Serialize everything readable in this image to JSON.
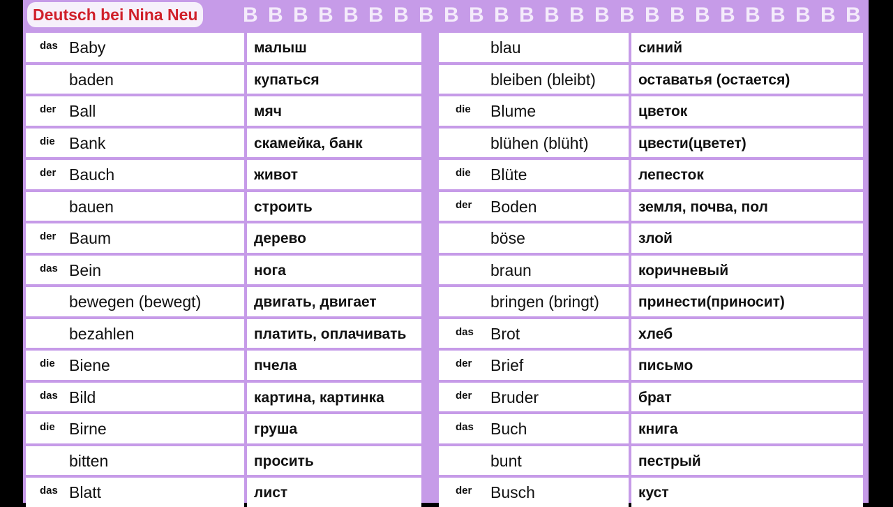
{
  "header": {
    "title": "Deutsch bei Nina Neu",
    "letters": "B B B B  B B B B  B B B  B B B B  B B B B  B B B B  B B B"
  },
  "left_column": [
    {
      "article": "das",
      "word": "Baby",
      "translation": "малыш"
    },
    {
      "article": "",
      "word": "baden",
      "translation": "купаться"
    },
    {
      "article": "der",
      "word": "Ball",
      "translation": "мяч"
    },
    {
      "article": "die",
      "word": "Bank",
      "translation": "скамейка, банк"
    },
    {
      "article": "der",
      "word": "Bauch",
      "translation": "живот"
    },
    {
      "article": "",
      "word": "bauen",
      "translation": "строить"
    },
    {
      "article": "der",
      "word": "Baum",
      "translation": "дерево"
    },
    {
      "article": "das",
      "word": "Bein",
      "translation": "нога"
    },
    {
      "article": "",
      "word": "bewegen (bewegt)",
      "translation": "двигать, двигает"
    },
    {
      "article": "",
      "word": "bezahlen",
      "translation": "платить, оплачивать"
    },
    {
      "article": "die",
      "word": "Biene",
      "translation": "пчела"
    },
    {
      "article": "das",
      "word": "Bild",
      "translation": "картина, картинка"
    },
    {
      "article": "die",
      "word": "Birne",
      "translation": "груша"
    },
    {
      "article": "",
      "word": "bitten",
      "translation": "просить"
    },
    {
      "article": "das",
      "word": "Blatt",
      "translation": "лист"
    }
  ],
  "right_column": [
    {
      "article": "",
      "word": "blau",
      "translation": "синий"
    },
    {
      "article": "",
      "word": "bleiben (bleibt)",
      "translation": "оставатья (остается)"
    },
    {
      "article": "die",
      "word": "Blume",
      "translation": "цветок"
    },
    {
      "article": "",
      "word": "blühen (blüht)",
      "translation": "цвести(цветет)"
    },
    {
      "article": "die",
      "word": "Blüte",
      "translation": "лепесток"
    },
    {
      "article": "der",
      "word": "Boden",
      "translation": "земля, почва, пол"
    },
    {
      "article": "",
      "word": "böse",
      "translation": "злой"
    },
    {
      "article": "",
      "word": "braun",
      "translation": "коричневый"
    },
    {
      "article": "",
      "word": "bringen (bringt)",
      "translation": "принести(приносит)"
    },
    {
      "article": "das",
      "word": "Brot",
      "translation": "хлеб"
    },
    {
      "article": "der",
      "word": "Brief",
      "translation": "письмо"
    },
    {
      "article": "der",
      "word": "Bruder",
      "translation": "брат"
    },
    {
      "article": "das",
      "word": "Buch",
      "translation": "книга"
    },
    {
      "article": "",
      "word": "bunt",
      "translation": "пестрый"
    },
    {
      "article": "der",
      "word": "Busch",
      "translation": "куст"
    }
  ]
}
